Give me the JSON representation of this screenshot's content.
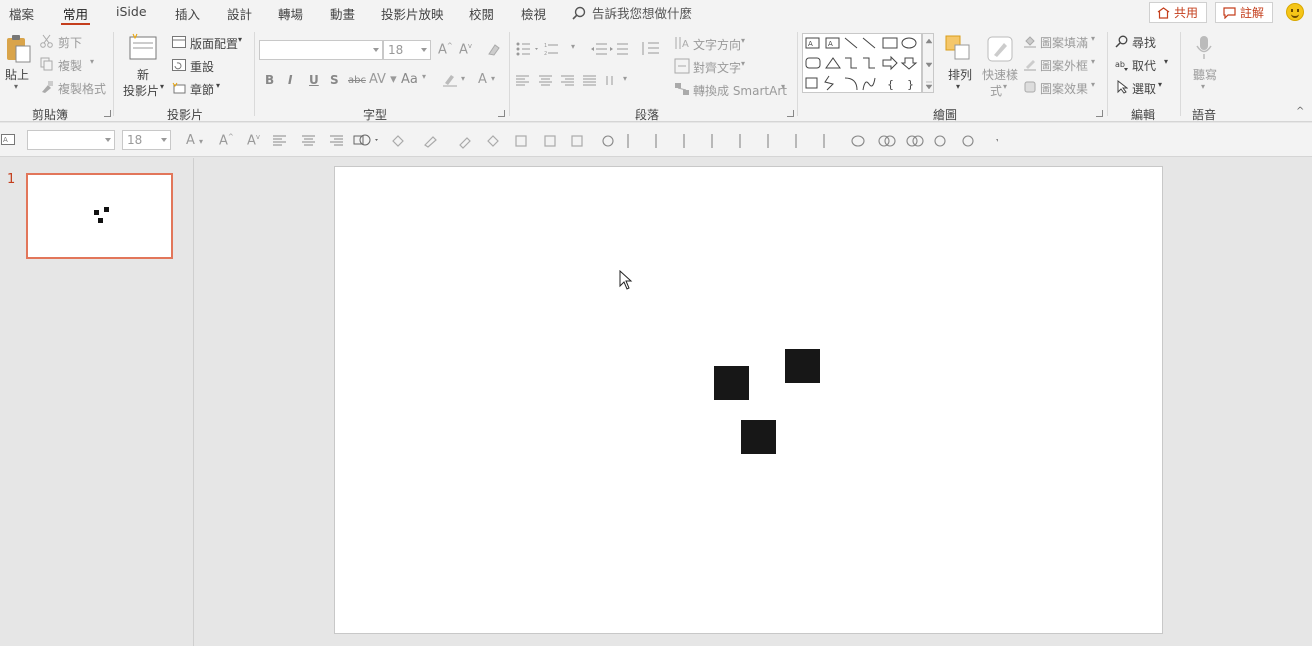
{
  "tabs": [
    "檔案",
    "常用",
    "iSide",
    "插入",
    "設計",
    "轉場",
    "動畫",
    "投影片放映",
    "校閱",
    "檢視"
  ],
  "active_tab": "常用",
  "tell_me": "告訴我您想做什麼",
  "share_label": "共用",
  "comments_label": "註解",
  "clipboard": {
    "paste": "貼上",
    "cut": "剪下",
    "copy": "複製",
    "format_painter": "複製格式",
    "group": "剪貼簿"
  },
  "slides": {
    "new_slide_line1": "新",
    "new_slide_line2": "投影片",
    "layout": "版面配置",
    "reset": "重設",
    "section": "章節",
    "group": "投影片"
  },
  "font": {
    "font_name": "",
    "font_size": "18",
    "group": "字型",
    "bold": "B",
    "italic": "I",
    "underline": "U",
    "shadow": "S",
    "strike": "abc",
    "case": "Aa"
  },
  "paragraph": {
    "text_direction": "文字方向",
    "align_text": "對齊文字",
    "smartart": "轉換成 SmartArt",
    "group": "段落"
  },
  "drawing": {
    "arrange": "排列",
    "quick_styles_1": "快速樣",
    "quick_styles_2": "式",
    "shape_fill": "圖案填滿",
    "shape_outline": "圖案外框",
    "shape_effects": "圖案效果",
    "group": "繪圖"
  },
  "editing": {
    "find": "尋找",
    "replace": "取代",
    "select": "選取",
    "group": "編輯"
  },
  "voice": {
    "dictate": "聽寫",
    "group": "語音"
  },
  "mini_toolbar": {
    "font_size": "18"
  },
  "thumbnail": {
    "number": "1"
  },
  "colors": {
    "accent": "#c43e1c",
    "thumb_border": "#e2765a",
    "shape": "#171717"
  }
}
